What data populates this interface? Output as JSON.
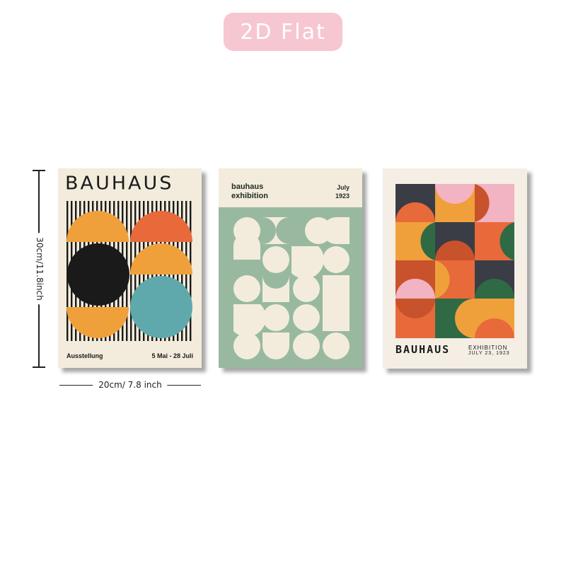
{
  "badge": {
    "label": "2D Flat"
  },
  "dimensions": {
    "height_label": "30cm/11.8inch",
    "width_label": "20cm/ 7.8 inch"
  },
  "posters": [
    {
      "title": "BAUHAUS",
      "footer_left": "Ausstellung",
      "footer_right": "5 Mai - 28 Juli"
    },
    {
      "title_line1": "bauhaus",
      "title_line2": "exhibition",
      "month": "July",
      "year": "1923"
    },
    {
      "title": "BAUHAUS",
      "subtitle_line1": "EXHIBITION",
      "subtitle_line2": "JULY 23, 1923"
    }
  ],
  "colors": {
    "badge": "#f6c6d1",
    "cream": "#f3ecdc",
    "black": "#1a1a1a",
    "orange": "#f0a03a",
    "red_orange": "#e86a3a",
    "teal": "#5fa9ad",
    "sage": "#98b9a0",
    "green": "#2f6a45",
    "brick": "#c8522c",
    "pink": "#f2b3c2",
    "charcoal": "#3a3d45"
  }
}
